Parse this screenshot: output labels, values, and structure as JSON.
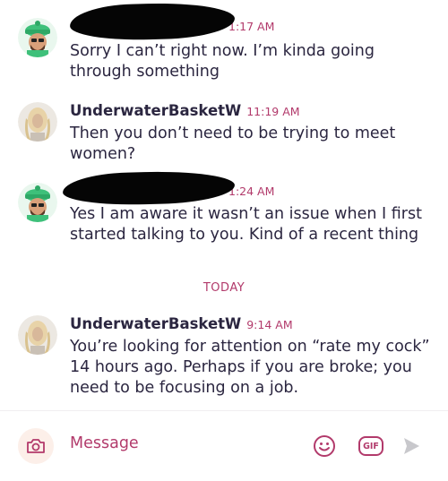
{
  "messages": [
    {
      "sender": "",
      "time": "1:17 AM",
      "text": "Sorry I can’t right now. I’m kinda going through something",
      "avatar": "green-hat-cartoon-avatar"
    },
    {
      "sender": "UnderwaterBasketW",
      "time": "11:19 AM",
      "text": "Then you don’t need to be trying to meet women?",
      "avatar": "blonde-woman-photo-avatar"
    },
    {
      "sender": "",
      "time": "1:24 AM",
      "text": "Yes I am aware it wasn’t an issue when I first started talking to you. Kind of a recent thing",
      "avatar": "green-hat-cartoon-avatar"
    },
    {
      "sender": "UnderwaterBasketW",
      "time": "9:14 AM",
      "text": "You’re looking for attention on “rate my cock” 14 hours ago. Perhaps if you are broke; you need to be focusing on a job.",
      "avatar": "blonde-woman-photo-avatar"
    }
  ],
  "divider": {
    "label": "TODAY"
  },
  "composer": {
    "placeholder": "Message",
    "gif_label": "GIF",
    "icons": [
      "camera-icon",
      "emoji-icon",
      "gif-icon",
      "send-icon"
    ]
  },
  "colors": {
    "accent": "#b23a6b",
    "text": "#2b2640",
    "avatar_green": "#3ec07a",
    "camera_bg": "#fcefe9"
  }
}
